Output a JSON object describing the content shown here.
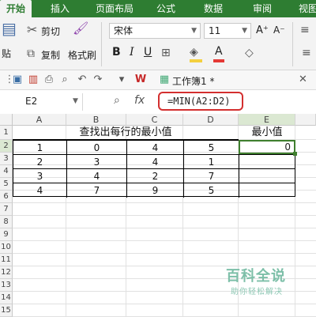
{
  "ribbon": {
    "tabs": [
      {
        "label": "开始",
        "active": true
      },
      {
        "label": "插入",
        "active": false
      },
      {
        "label": "页面布局",
        "active": false
      },
      {
        "label": "公式",
        "active": false
      },
      {
        "label": "数据",
        "active": false
      },
      {
        "label": "审阅",
        "active": false
      },
      {
        "label": "视图",
        "active": false
      }
    ],
    "paste_label": "贴",
    "cut_label": "剪切",
    "copy_label": "复制",
    "format_painter_label": "格式刷",
    "font_name": "宋体",
    "font_size": "11",
    "accent_color": "#2e7d32",
    "font_color_bar": "#e53935",
    "highlight_color_bar": "#f4d03f"
  },
  "quick_access": {
    "workbook_tab": "工作簿1 *"
  },
  "formula_bar": {
    "cell_ref": "E2",
    "fx_label": "fx",
    "formula": "=MIN(A2:D2)",
    "highlight_color": "#d32f2f"
  },
  "sheet": {
    "columns": [
      "A",
      "B",
      "C",
      "D",
      "E"
    ],
    "row_numbers": [
      "1",
      "2",
      "3",
      "4",
      "5",
      "6",
      "7",
      "8",
      "9",
      "10",
      "11",
      "12",
      "13",
      "14",
      "15"
    ],
    "title": "查找出每行的最小值",
    "e1_header": "最小值",
    "rows": [
      [
        "1",
        "0",
        "4",
        "5"
      ],
      [
        "2",
        "3",
        "4",
        "1"
      ],
      [
        "3",
        "4",
        "2",
        "7"
      ],
      [
        "4",
        "7",
        "9",
        "5"
      ]
    ],
    "e2_value": "0"
  },
  "watermark": {
    "title": "百科全说",
    "subtitle": "助你轻松解决"
  }
}
